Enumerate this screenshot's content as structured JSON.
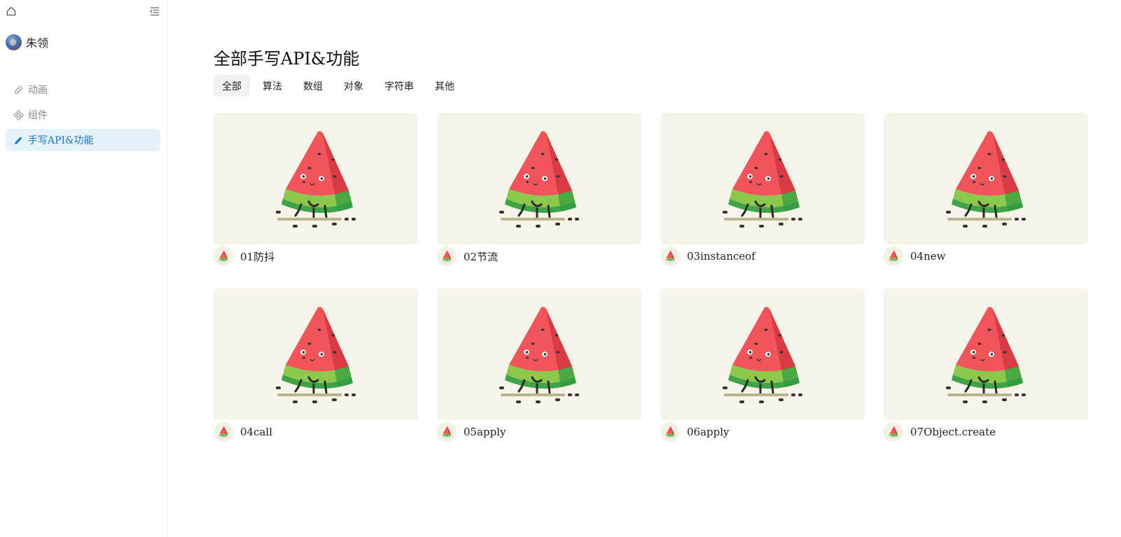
{
  "sidebar": {
    "user_name": "朱领",
    "items": [
      {
        "label": "动画",
        "icon": "bandage-icon",
        "active": false
      },
      {
        "label": "组件",
        "icon": "components-icon",
        "active": false
      },
      {
        "label": "手写API&功能",
        "icon": "pencil-icon",
        "active": true
      }
    ]
  },
  "main": {
    "title": "全部手写API&功能",
    "tabs": [
      {
        "label": "全部",
        "active": true
      },
      {
        "label": "算法",
        "active": false
      },
      {
        "label": "数组",
        "active": false
      },
      {
        "label": "对象",
        "active": false
      },
      {
        "label": "字符串",
        "active": false
      },
      {
        "label": "其他",
        "active": false
      }
    ],
    "cards": [
      {
        "title": "01防抖",
        "image": "watermelon-character"
      },
      {
        "title": "02节流",
        "image": "watermelon-character"
      },
      {
        "title": "03instanceof",
        "image": "watermelon-character"
      },
      {
        "title": "04new",
        "image": "watermelon-character"
      },
      {
        "title": "04call",
        "image": "watermelon-character"
      },
      {
        "title": "05apply",
        "image": "watermelon-character"
      },
      {
        "title": "06apply",
        "image": "watermelon-character"
      },
      {
        "title": "07Object.create",
        "image": "watermelon-character"
      }
    ]
  },
  "colors": {
    "accent": "#1677c8",
    "active_nav_bg": "#e6f2fc",
    "card_bg": "#f6f4e9",
    "watermelon_red": "#f2545b",
    "watermelon_green": "#4caf50"
  }
}
